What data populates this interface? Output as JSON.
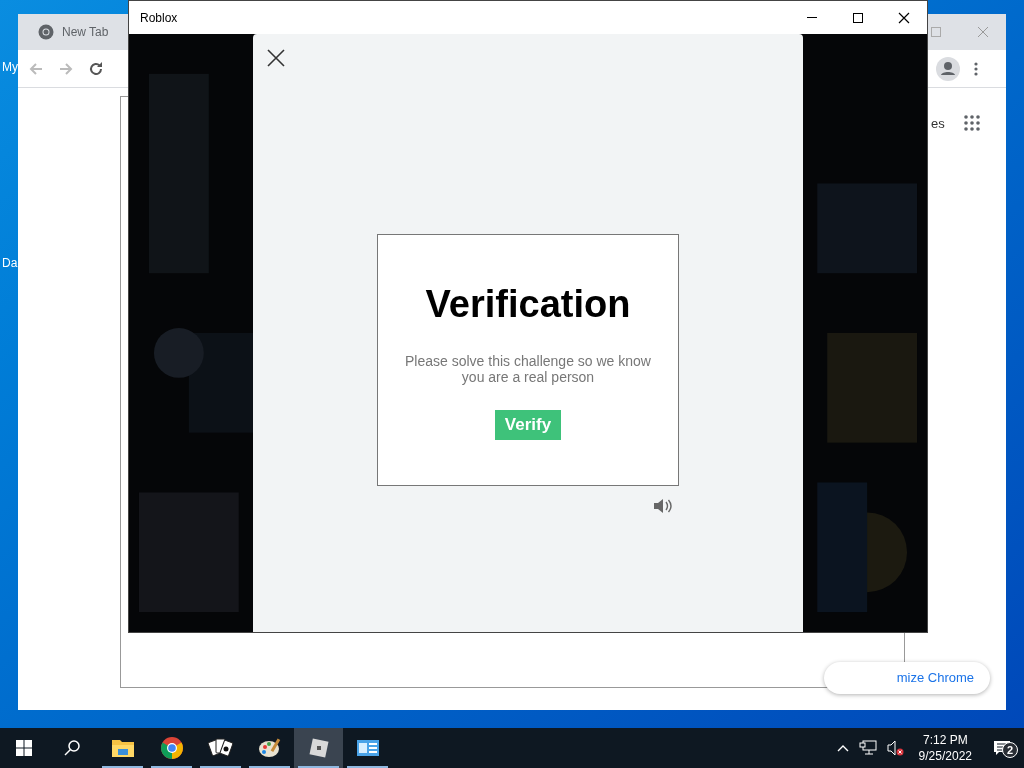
{
  "desktop_icons": [
    {
      "label": "My"
    },
    {
      "label": "Da"
    }
  ],
  "browser": {
    "tab": {
      "title": "New Tab"
    },
    "link": "es",
    "customize_button": "mize Chrome"
  },
  "game_window": {
    "title": "Roblox"
  },
  "verification": {
    "title": "Verification",
    "message": "Please solve this challenge so we know you are a real person",
    "button": "Verify",
    "sound_muted": false
  },
  "taskbar": {
    "apps": [
      {
        "kind": "file-explorer",
        "selected": false,
        "running": true
      },
      {
        "kind": "chrome",
        "selected": false,
        "running": true
      },
      {
        "kind": "solitaire",
        "selected": false,
        "running": true
      },
      {
        "kind": "paint",
        "selected": false,
        "running": true
      },
      {
        "kind": "roblox",
        "selected": true,
        "running": true
      },
      {
        "kind": "control-panel",
        "selected": false,
        "running": true
      }
    ],
    "volume_muted": true,
    "time": "7:12 PM",
    "date": "9/25/2022",
    "notification_count": "2"
  }
}
